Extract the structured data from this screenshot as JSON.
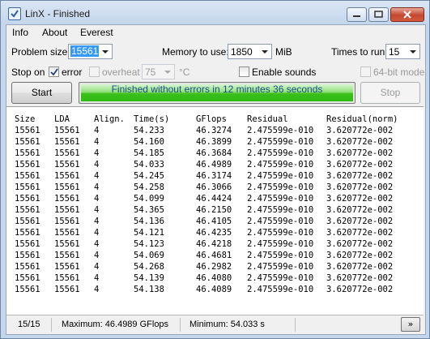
{
  "window": {
    "title": "LinX - Finished"
  },
  "menu": {
    "items": [
      "Info",
      "About",
      "Everest"
    ]
  },
  "controls": {
    "problem_size_label": "Problem size:",
    "problem_size_value": "15561",
    "memory_label": "Memory to use:",
    "memory_value": "1850",
    "memory_unit": "MiB",
    "times_label": "Times to run:",
    "times_value": "15",
    "stop_on_label": "Stop on",
    "error_label": "error",
    "error_checked": true,
    "overheat_label": "overheat",
    "overheat_value": "75",
    "overheat_unit": "°C",
    "enable_sounds_label": "Enable sounds",
    "mode64_label": "64-bit mode",
    "start_label": "Start",
    "stop_label": "Stop"
  },
  "progress": {
    "text": "Finished without errors in 12 minutes 36 seconds",
    "fraction": 1.0
  },
  "results": {
    "headers": [
      "Size",
      "LDA",
      "Align.",
      "Time(s)",
      "GFlops",
      "Residual",
      "Residual(norm)"
    ],
    "rows": [
      [
        "15561",
        "15561",
        "4",
        "54.233",
        "46.3274",
        "2.475599e-010",
        "3.620772e-002"
      ],
      [
        "15561",
        "15561",
        "4",
        "54.160",
        "46.3899",
        "2.475599e-010",
        "3.620772e-002"
      ],
      [
        "15561",
        "15561",
        "4",
        "54.185",
        "46.3684",
        "2.475599e-010",
        "3.620772e-002"
      ],
      [
        "15561",
        "15561",
        "4",
        "54.033",
        "46.4989",
        "2.475599e-010",
        "3.620772e-002"
      ],
      [
        "15561",
        "15561",
        "4",
        "54.245",
        "46.3174",
        "2.475599e-010",
        "3.620772e-002"
      ],
      [
        "15561",
        "15561",
        "4",
        "54.258",
        "46.3066",
        "2.475599e-010",
        "3.620772e-002"
      ],
      [
        "15561",
        "15561",
        "4",
        "54.099",
        "46.4424",
        "2.475599e-010",
        "3.620772e-002"
      ],
      [
        "15561",
        "15561",
        "4",
        "54.365",
        "46.2150",
        "2.475599e-010",
        "3.620772e-002"
      ],
      [
        "15561",
        "15561",
        "4",
        "54.136",
        "46.4105",
        "2.475599e-010",
        "3.620772e-002"
      ],
      [
        "15561",
        "15561",
        "4",
        "54.121",
        "46.4235",
        "2.475599e-010",
        "3.620772e-002"
      ],
      [
        "15561",
        "15561",
        "4",
        "54.123",
        "46.4218",
        "2.475599e-010",
        "3.620772e-002"
      ],
      [
        "15561",
        "15561",
        "4",
        "54.069",
        "46.4681",
        "2.475599e-010",
        "3.620772e-002"
      ],
      [
        "15561",
        "15561",
        "4",
        "54.268",
        "46.2982",
        "2.475599e-010",
        "3.620772e-002"
      ],
      [
        "15561",
        "15561",
        "4",
        "54.139",
        "46.4080",
        "2.475599e-010",
        "3.620772e-002"
      ],
      [
        "15561",
        "15561",
        "4",
        "54.138",
        "46.4089",
        "2.475599e-010",
        "3.620772e-002"
      ]
    ]
  },
  "status": {
    "runs": "15/15",
    "maximum": "Maximum: 46.4989 GFlops",
    "minimum": "Minimum: 54.033 s",
    "expand_label": "»"
  },
  "colors": {
    "progress_green": "#3bc01a",
    "progress_text": "#1b4d8c",
    "selection": "#3399ff"
  },
  "icons": [
    "check-icon",
    "minimize-icon",
    "maximize-icon",
    "close-icon",
    "chevron-down-icon"
  ]
}
